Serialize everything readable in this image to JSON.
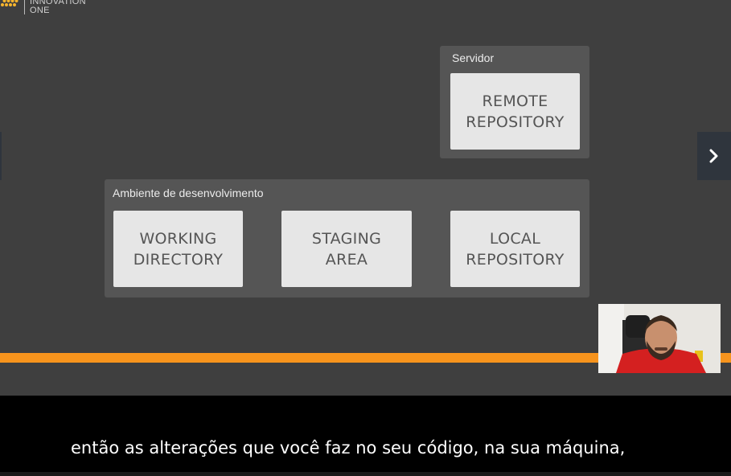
{
  "logo": {
    "line1": "INNOVATION",
    "line2": "ONE",
    "icon": "hexagon-grid-icon"
  },
  "servidor": {
    "title": "Servidor",
    "box": [
      "REMOTE",
      "REPOSITORY"
    ]
  },
  "ambiente": {
    "title": "Ambiente de desenvolvimento",
    "boxes": [
      {
        "line1": "WORKING",
        "line2": "DIRECTORY"
      },
      {
        "line1": "STAGING",
        "line2": "AREA"
      },
      {
        "line1": "LOCAL",
        "line2": "REPOSITORY"
      }
    ]
  },
  "nav": {
    "next_icon": "chevron-right-icon"
  },
  "caption": {
    "text": "então as alterações que você faz no seu código, na sua máquina,"
  },
  "colors": {
    "background": "#3f3f3f",
    "panel": "#555555",
    "box": "#e6e6e6",
    "progress": "#f7941d",
    "caption_band": "#000000"
  }
}
